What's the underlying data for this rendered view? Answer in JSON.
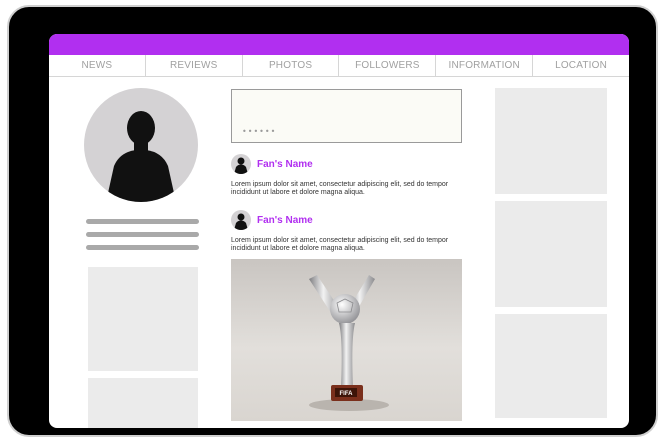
{
  "nav": {
    "items": [
      "NEWS",
      "REVIEWS",
      "PHOTOS",
      "FOLLOWERS",
      "INFORMATION",
      "LOCATION"
    ]
  },
  "compose": {
    "placeholder": "••••••"
  },
  "posts": [
    {
      "name": "Fan's Name",
      "text": "Lorem ipsum dolor sit amet, consectetur adipiscing elit, sed do tempor incididunt ut labore et dolore magna aliqua."
    },
    {
      "name": "Fan's Name",
      "text": "Lorem ipsum dolor sit amet, consectetur adipiscing elit, sed do tempor incididunt ut labore et dolore magna aliqua."
    }
  ],
  "photo": {
    "badge": "FIFA"
  },
  "colors": {
    "accent": "#b12ff0",
    "bezel": "#000000",
    "placeholder_box": "#ebebeb"
  },
  "icons": {
    "profile": "person-silhouette-icon",
    "trophy": "trophy-image"
  }
}
